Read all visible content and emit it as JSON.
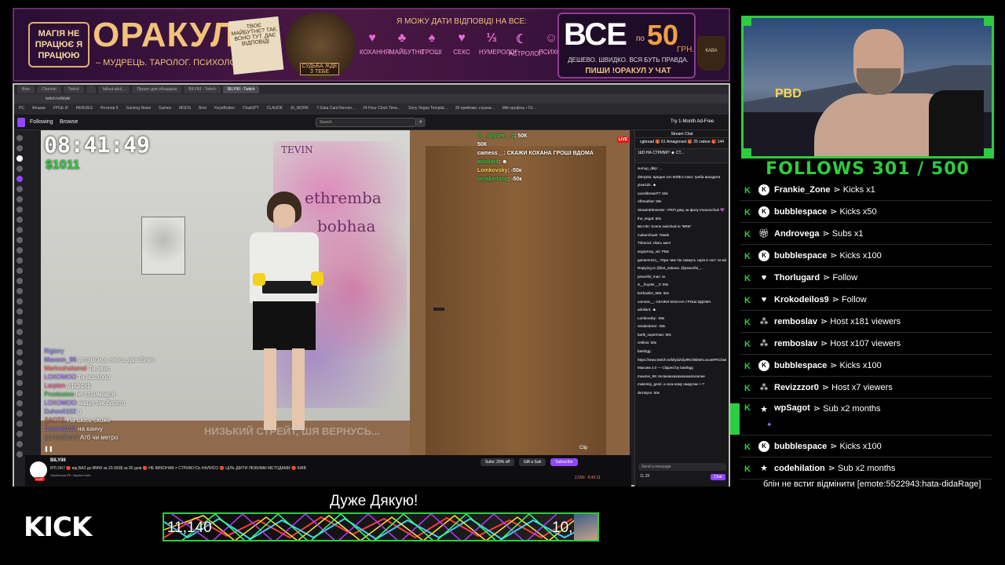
{
  "banner": {
    "magic_badge": "МАГІЯ НЕ ПРАЦЮЄ Я ПРАЦЮЮ",
    "title": "ОРАКУЛ",
    "subtitle": "– МУДРЕЦЬ. ТАРОЛОГ. ПСИХОЛОГ. –",
    "note": "ТВОЄ МАЙБУТНЄ? ТАК, ВОНО ТУТ. ДАЄ ВІДПОВІДІ",
    "wizard_tag": "СУДЬБА ЖДЕ З ТЕБЕ",
    "headline": "Я МОЖУ ДАТИ ВІДПОВІДІ НА ВСЕ:",
    "services": [
      "КОХАННЯ",
      "МАЙБУТНЄ",
      "ГРОШІ",
      "СЕКС",
      "НУМЕРОЛОГ",
      "АСТРОЛОГ",
      "ПСИХОЛОГ"
    ],
    "service_icons": [
      "♥",
      "♣",
      "♠",
      "♥",
      "⅓",
      "☾",
      "☺"
    ],
    "offer_big": "ВСЕ",
    "offer_po": "по",
    "offer_price": "50",
    "offer_currency": "ГРН.",
    "offer_tagline": "ДЕШЕВО. ШВИДКО. ВСЯ БУТЬ ПРАВДА.",
    "offer_cta": "ПИШИ !ОРАКУЛ У ЧАТ",
    "cup": "КАВА"
  },
  "browser": {
    "tabs": [
      "Bots",
      "Channel",
      "Twitch",
      "",
      "fallout.wiki/...",
      "Проєкт для обсидіана",
      "BILYIIII - Twitch",
      "BILYIIII - Twitch"
    ],
    "address": "twitch.tv/bilyiiii",
    "bookmarks": [
      "PC",
      "Фільми",
      "FPGE.III",
      "HEROES",
      "Нотатки 5",
      "Gaming News",
      "Games",
      "MODS",
      "Bots",
      "KeyeBotten",
      "ChatGPT",
      "CLAUDE",
      "AI_WORK",
      "7-Gata Card Recom...",
      "24 Hour Clock Time...",
      "Sony Vegas Templat...",
      "30 прийоми, страни...",
      "Мій профіль • OI..."
    ]
  },
  "twitch_nav": {
    "following": "Following",
    "browse": "Browse",
    "search_placeholder": "Search",
    "prime": "Try 1-Month Ad-Free"
  },
  "video": {
    "clock": "08:41:49",
    "money": "$1011",
    "live": "LIVE",
    "wall_text": [
      "ethremba",
      "bobhaa",
      "TEVIN"
    ],
    "overlay_chat": [
      {
        "user": "S__lloyder__0",
        "text": "50К",
        "color": "#2ecc40"
      },
      {
        "user": "",
        "text": "50К",
        "color": "#fff"
      },
      {
        "user": "camess__",
        "text": "СКАЖИ КОХАНА ГРОШІ ВДОМА",
        "color": "#fff"
      },
      {
        "user": "adollar4",
        "text": "☻",
        "color": "#2ecc40"
      },
      {
        "user": "Lomkovsky",
        "text": "-50к",
        "color": "#ffd84a"
      },
      {
        "user": "omakedone",
        "text": "-50к",
        "color": "#2ecc40"
      }
    ],
    "bottom_chat": [
      {
        "user": "Rigtory",
        "text": "",
        "color": "#8080ff"
      },
      {
        "user": "Maxson_96",
        "text": "устрились якось два білих",
        "color": "#8a6cff"
      },
      {
        "user": "Markoshalamal",
        "text": "Ти звис",
        "color": "#ff6b6b"
      },
      {
        "user": "LOXOMOO",
        "text": "та всьоооо",
        "color": "#a06cff"
      },
      {
        "user": "Larpten",
        "text": "уфффф",
        "color": "#ff5a8a"
      },
      {
        "user": "Prostostoo",
        "text": "не стримався",
        "color": "#2ecc40"
      },
      {
        "user": "LOXOMOO",
        "text": "нащо так багато",
        "color": "#a06cff"
      },
      {
        "user": "Duhov0102",
        "text": "р",
        "color": "#8080ff"
      },
      {
        "user": "ДАОТЕ",
        "text": "На шось схоже",
        "color": "#d06060"
      },
      {
        "user": "Duhov0102",
        "text": "на канчу",
        "color": "#8080ff"
      },
      {
        "user": "jaurmalamal",
        "text": "Атб чи метро",
        "color": "#888"
      }
    ],
    "caption": "НИЗЬКИЙ СТРЕЙТ, ШЯ ВЕРНУСЬ...",
    "clip": "Clip"
  },
  "stream_info": {
    "name": "BILYIIII",
    "title": "ІРЛ 24/7 🔴 від ВАЗ до BMW за 20.000$ за 30 днів 🔴 НЕ ВИКОНАВ = СТРИЖУСЬ НАЛИСО 🔴 ЦІЛЬ ДІЙТИ ЛЮБИМИ МЕТОДАМИ 🔴 КИЇВ",
    "tags": "Українська  IRL  Україна  Київ",
    "bits": "Subs: 29% off",
    "gift": "Gift a Sub",
    "subscribe": "Subscribe",
    "viewers": "2,090",
    "uptime": "8:43:11"
  },
  "twitch_chat": {
    "header": "Stream Chat",
    "gifters": [
      "cgbread 🎁 61",
      "Amagenset 🎁 25",
      "cwbee 🎁 144"
    ],
    "pinned": "ШО НА СТРИМІ? ☻ СТ...",
    "messages": [
      "sumup_dklp: ...",
      "d3mj1ka: вредне хоч 500$ в плюс треба виходити",
      "yiew1ds: ☻",
      "cacekbread77: 50к",
      "Albmarket: 50к",
      "StreamElements: +РЕП дяку за фолу Imaxonchuk 💜",
      "the_segat: 50к",
      "BILYIIII: Scene switched to \"BRB\"",
      "makarchuak: Помія",
      "Triborod: єбать мені",
      "argoproxy_art: РЕБ",
      "gamemrs21_: Юра чим тію скижуть скрін в чатт ти мій накрутки",
      "Replying to @bot_zabava: @peaceful_...",
      "peaceful_max: кх",
      "S__lloyder__0: 50к",
      "borbazkin_555: 50к",
      "camess__: СКАЖИ КОХАНА ГРОШІ ВДОМА",
      "adollar4: ☻",
      "Lomkovsky: -50к",
      "omakedone: -50к",
      "barlk_superman: 50к",
      "vetikos: 50к",
      "batshgg:",
      "https://www.twitch.tv/bilyiiii/clip/RichBitterLocustFRChase-xMrvnHgr",
      "Максим 2.0 — Clipped by batshgg",
      "maxson_96: вслахаахахахахахалалалае",
      "malenkiy_genii: а скок кому накрутки +-?",
      "de1styvx: 50к"
    ],
    "input_placeholder": "Send a message",
    "points": "11.2K",
    "chat_btn": "Chat"
  },
  "webcam": {
    "sign": "PBD"
  },
  "follow_goal": "FOLLOWS 301 / 500",
  "events": [
    {
      "icon": "kick",
      "user": "Frankie_Zone",
      "text": "⋗ Kicks x1"
    },
    {
      "icon": "kick",
      "user": "bubblespace",
      "text": "⋗ Kicks x50"
    },
    {
      "icon": "gift",
      "user": "Androvega",
      "text": "⋗ Subs x1"
    },
    {
      "icon": "kick",
      "user": "bubblespace",
      "text": "⋗ Kicks x100"
    },
    {
      "icon": "heart",
      "user": "Thorlugard",
      "text": "⋗ Follow"
    },
    {
      "icon": "heart",
      "user": "Krokodeilos9",
      "text": "⋗ Follow"
    },
    {
      "icon": "host",
      "user": "remboslav",
      "text": "⋗ Host x181 viewers"
    },
    {
      "icon": "host",
      "user": "remboslav",
      "text": "⋗ Host x107 viewers"
    },
    {
      "icon": "kick",
      "user": "bubblespace",
      "text": "⋗ Kicks x100"
    },
    {
      "icon": "host",
      "user": "Revizzzor0",
      "text": "⋗ Host x7 viewers"
    },
    {
      "icon": "star",
      "user": "wpSagot",
      "text": "⋗ Sub x2 months"
    },
    {
      "icon": "kick",
      "user": "bubblespace",
      "text": "⋗ Kicks x100"
    },
    {
      "icon": "star",
      "user": "codehilation",
      "text": "⋗ Sub x2 months"
    }
  ],
  "last_message": "блін не встиг відмінити [emote:5522943:hata-didaRage]",
  "kick_logo": "KICK",
  "thanks": "Дуже Дякую!",
  "goal_bar": {
    "left": "11,140",
    "right": "10,"
  }
}
